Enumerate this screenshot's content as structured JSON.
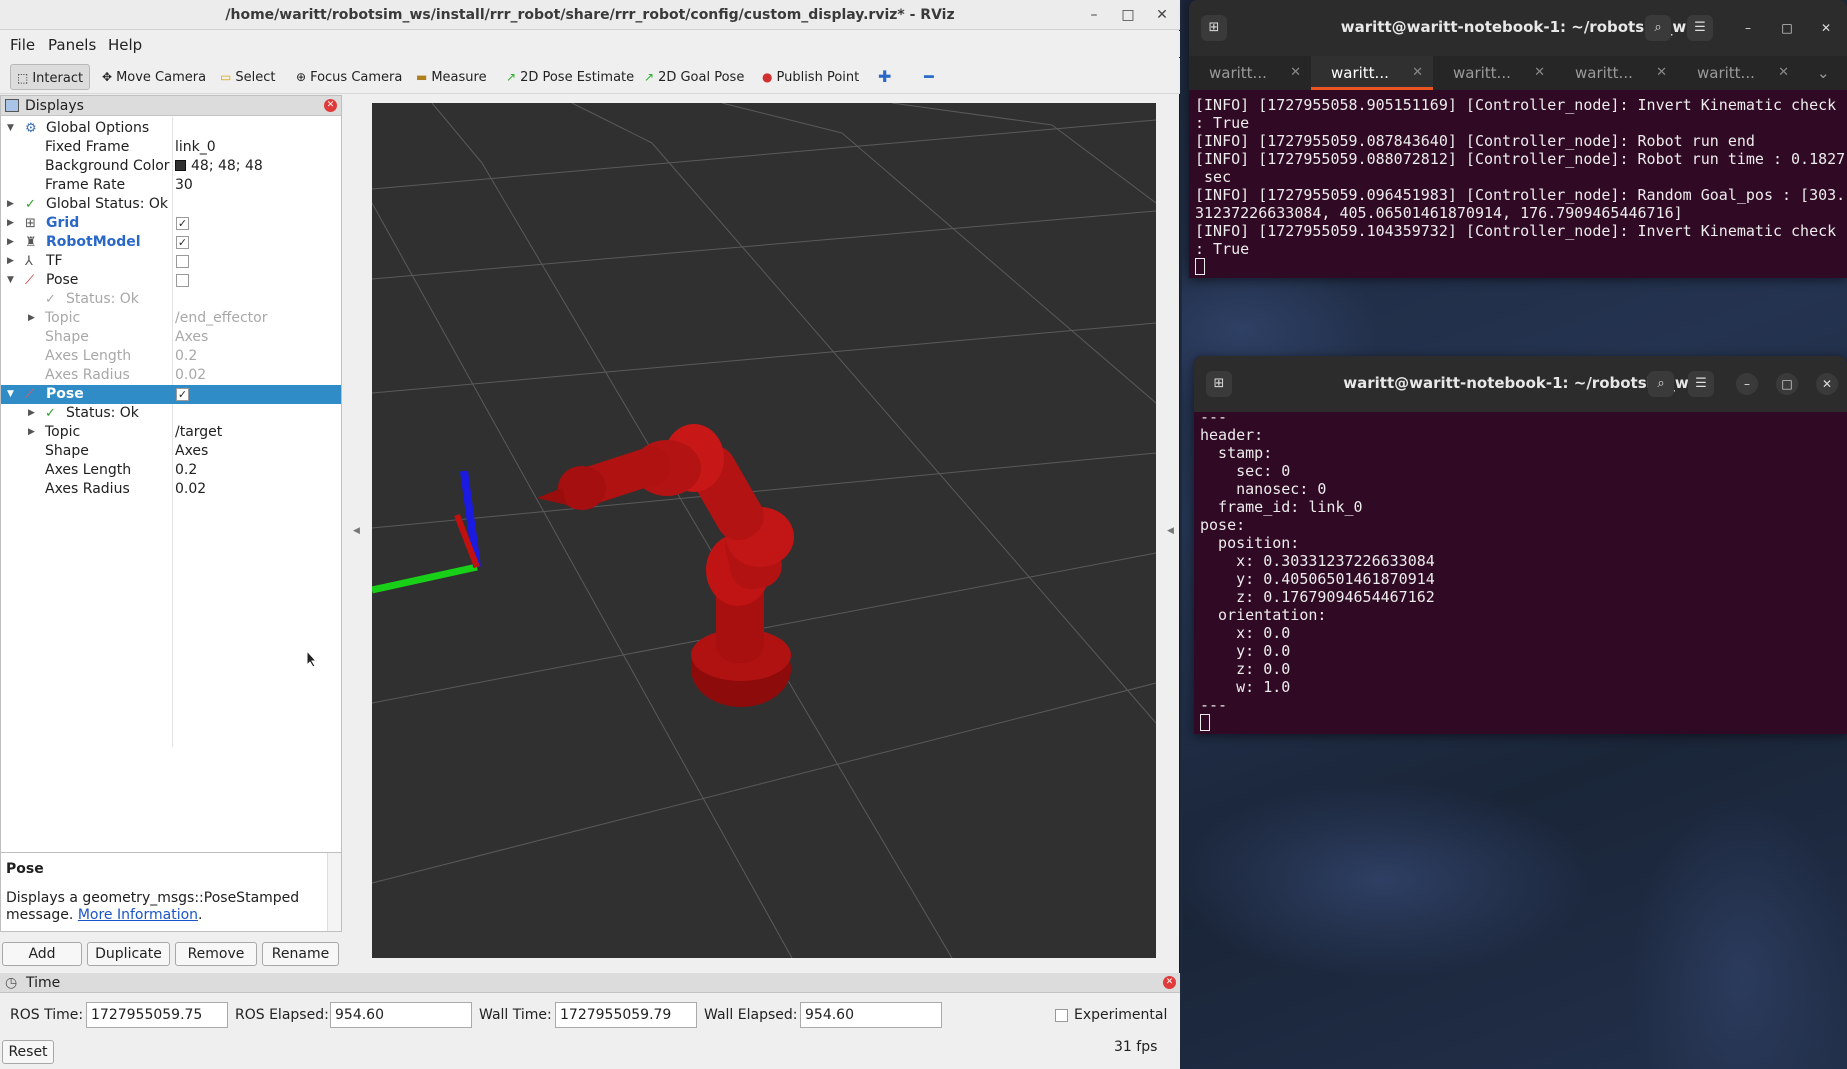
{
  "rviz": {
    "title": "/home/waritt/robotsim_ws/install/rrr_robot/share/rrr_robot/config/custom_display.rviz* - RViz",
    "menu": [
      "File",
      "Panels",
      "Help"
    ],
    "tools": [
      "Interact",
      "Move Camera",
      "Select",
      "Focus Camera",
      "Measure",
      "2D Pose Estimate",
      "2D Goal Pose",
      "Publish Point"
    ],
    "displays_title": "Displays",
    "tree": {
      "global_options": "Global Options",
      "fixed_frame_label": "Fixed Frame",
      "fixed_frame_value": "link_0",
      "bg_color_label": "Background Color",
      "bg_color_value": "48; 48; 48",
      "frame_rate_label": "Frame Rate",
      "frame_rate_value": "30",
      "global_status": "Global Status: Ok",
      "grid": "Grid",
      "grid_checked": true,
      "robot_model": "RobotModel",
      "robot_model_checked": true,
      "tf": "TF",
      "tf_checked": false,
      "pose1": {
        "name": "Pose",
        "checked": false,
        "status": "Status: Ok",
        "topic_label": "Topic",
        "topic": "/end_effector",
        "shape_label": "Shape",
        "shape": "Axes",
        "axes_length_label": "Axes Length",
        "axes_length": "0.2",
        "axes_radius_label": "Axes Radius",
        "axes_radius": "0.02"
      },
      "pose2": {
        "name": "Pose",
        "checked": true,
        "status": "Status: Ok",
        "topic_label": "Topic",
        "topic": "/target",
        "shape_label": "Shape",
        "shape": "Axes",
        "axes_length_label": "Axes Length",
        "axes_length": "0.2",
        "axes_radius_label": "Axes Radius",
        "axes_radius": "0.02"
      }
    },
    "description": {
      "title": "Pose",
      "text": "Displays a geometry_msgs::PoseStamped message.",
      "link": "More Information",
      "after_link": "."
    },
    "buttons": [
      "Add",
      "Duplicate",
      "Remove",
      "Rename"
    ],
    "time": {
      "title": "Time",
      "ros_time_label": "ROS Time:",
      "ros_time": "1727955059.75",
      "ros_elapsed_label": "ROS Elapsed:",
      "ros_elapsed": "954.60",
      "wall_time_label": "Wall Time:",
      "wall_time": "1727955059.79",
      "wall_elapsed_label": "Wall Elapsed:",
      "wall_elapsed": "954.60",
      "experimental_label": "Experimental",
      "reset_label": "Reset",
      "fps": "31 fps"
    },
    "colors": {
      "view_bg": "#303030",
      "robot": "#b80e0e",
      "selection": "#308cc6"
    }
  },
  "terminal1": {
    "title": "waritt@waritt-notebook-1: ~/robotsim_ws",
    "tabs": [
      "waritt...",
      "waritt...",
      "waritt...",
      "waritt...",
      "waritt..."
    ],
    "active_tab": 1,
    "lines": [
      "[INFO] [1727955058.905151169] [Controller_node]: Invert Kinematic check",
      ": True",
      "[INFO] [1727955059.087843640] [Controller_node]: Robot run end",
      "[INFO] [1727955059.088072812] [Controller_node]: Robot run time : 0.1827",
      " sec",
      "[INFO] [1727955059.096451983] [Controller_node]: Random Goal_pos : [303.",
      "31237226633084, 405.06501461870914, 176.7909465446716]",
      "[INFO] [1727955059.104359732] [Controller_node]: Invert Kinematic check",
      ": True"
    ]
  },
  "terminal2": {
    "title": "waritt@waritt-notebook-1: ~/robotsim_ws",
    "lines": [
      "---",
      "header:",
      "  stamp:",
      "    sec: 0",
      "    nanosec: 0",
      "  frame_id: link_0",
      "pose:",
      "  position:",
      "    x: 0.30331237226633084",
      "    y: 0.40506501461870914",
      "    z: 0.17679094654467162",
      "  orientation:",
      "    x: 0.0",
      "    y: 0.0",
      "    z: 0.0",
      "    w: 1.0",
      "---"
    ]
  }
}
